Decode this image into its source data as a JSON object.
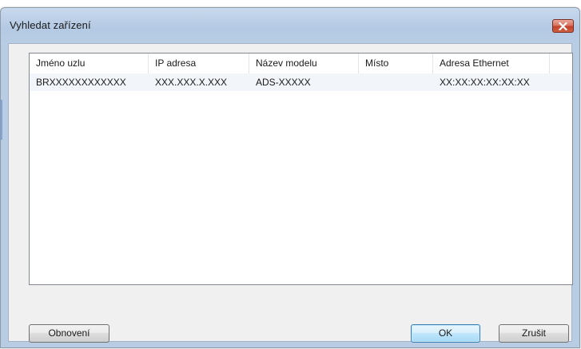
{
  "window": {
    "title": "Vyhledat zařízení"
  },
  "icons": {
    "close": "close-icon"
  },
  "colors": {
    "title_gradient_top": "#c9daee",
    "close_button": "#c2432c",
    "default_button_border": "#3c7fb1",
    "list_row_bg": "#f2f5f9"
  },
  "list": {
    "columns": [
      {
        "label": "Jméno uzlu"
      },
      {
        "label": "IP adresa"
      },
      {
        "label": "Název modelu"
      },
      {
        "label": "Místo"
      },
      {
        "label": "Adresa Ethernet"
      }
    ],
    "rows": [
      {
        "node_name": "BRXXXXXXXXXXXX",
        "ip_address": "XXX.XXX.X.XXX",
        "model_name": "ADS-XXXXX",
        "location": "",
        "ethernet": "XX:XX:XX:XX:XX:XX"
      }
    ]
  },
  "buttons": {
    "refresh": "Obnovení",
    "ok": "OK",
    "cancel": "Zrušit"
  }
}
